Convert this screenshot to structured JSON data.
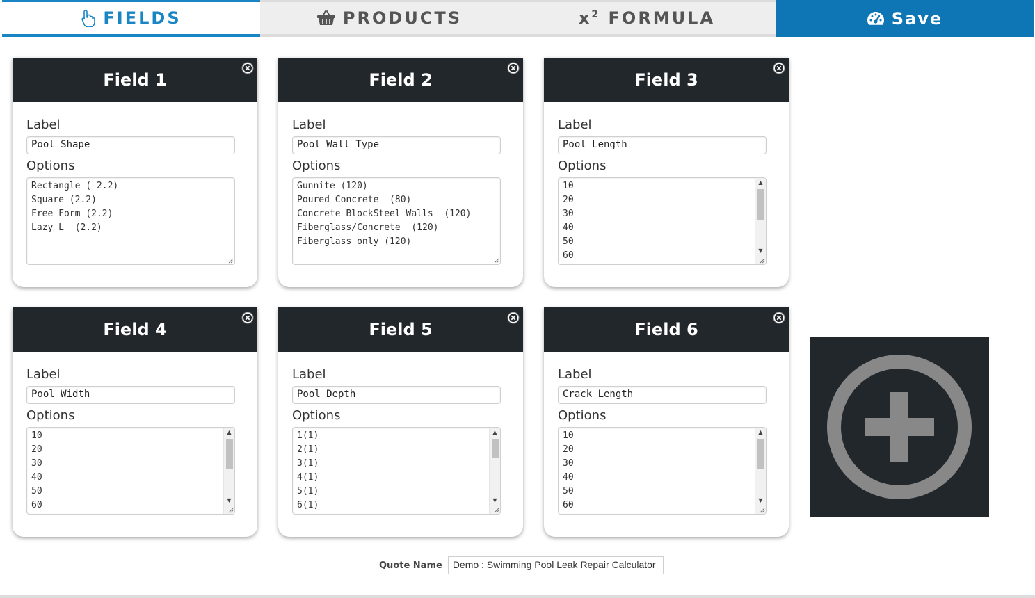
{
  "tabs": {
    "fields": "FIELDS",
    "products": "PRODUCTS",
    "formula_prefix": "x",
    "formula_sup": "2",
    "formula": "FORMULA",
    "save": "Save"
  },
  "icons": {
    "fields": "hand-pointer-icon",
    "products": "shopping-basket-icon",
    "save": "dashboard-icon",
    "close": "close-circle-icon",
    "add": "plus-circle-icon"
  },
  "colors": {
    "accent": "#1a85c4",
    "save_bg": "#0e76b4",
    "card_header": "#22272b"
  },
  "fields": [
    {
      "title": "Field 1",
      "label_caption": "Label",
      "label_value": "Pool Shape",
      "options_caption": "Options",
      "options": "Rectangle ( 2.2)\nSquare (2.2)\nFree Form (2.2)\nLazy L  (2.2)"
    },
    {
      "title": "Field 2",
      "label_caption": "Label",
      "label_value": "Pool Wall Type",
      "options_caption": "Options",
      "options": "Gunnite (120)\nPoured Concrete  (80)\nConcrete BlockSteel Walls  (120)\nFiberglass/Concrete  (120)\nFiberglass only (120)"
    },
    {
      "title": "Field 3",
      "label_caption": "Label",
      "label_value": "Pool Length",
      "options_caption": "Options",
      "options": "10\n20\n30\n40\n50\n60"
    },
    {
      "title": "Field 4",
      "label_caption": "Label",
      "label_value": "Pool Width",
      "options_caption": "Options",
      "options": "10\n20\n30\n40\n50\n60"
    },
    {
      "title": "Field 5",
      "label_caption": "Label",
      "label_value": "Pool Depth",
      "options_caption": "Options",
      "options": "1(1)\n2(1)\n3(1)\n4(1)\n5(1)\n6(1)"
    },
    {
      "title": "Field 6",
      "label_caption": "Label",
      "label_value": "Crack Length",
      "options_caption": "Options",
      "options": "10\n20\n30\n40\n50\n60"
    }
  ],
  "quote": {
    "label": "Quote Name",
    "value": "Demo : Swimming Pool Leak Repair Calculator"
  }
}
